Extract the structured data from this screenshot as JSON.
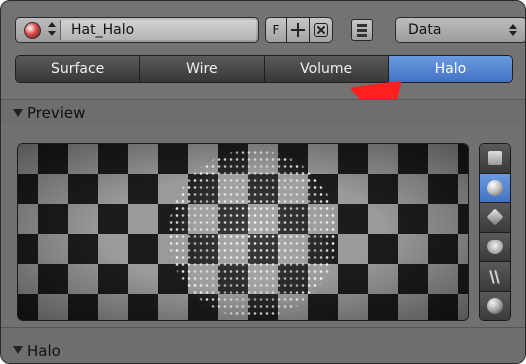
{
  "header": {
    "material_name": "Hat_Halo",
    "fake_user_label": "F",
    "context_select": "Data"
  },
  "tabs": [
    {
      "label": "Surface",
      "active": false
    },
    {
      "label": "Wire",
      "active": false
    },
    {
      "label": "Volume",
      "active": false
    },
    {
      "label": "Halo",
      "active": true
    }
  ],
  "sections": {
    "preview": "Preview",
    "halo": "Halo"
  },
  "preview_shapes": [
    {
      "icon": "flat-icon",
      "active": false
    },
    {
      "icon": "sphere-icon",
      "active": true
    },
    {
      "icon": "cube-icon",
      "active": false
    },
    {
      "icon": "monkey-icon",
      "active": false
    },
    {
      "icon": "hair-icon",
      "active": false
    },
    {
      "icon": "world-sphere-icon",
      "active": false
    }
  ],
  "colors": {
    "panel_bg": "#737373",
    "tab_active": "#5584d2",
    "annotation": "#ff2020"
  }
}
